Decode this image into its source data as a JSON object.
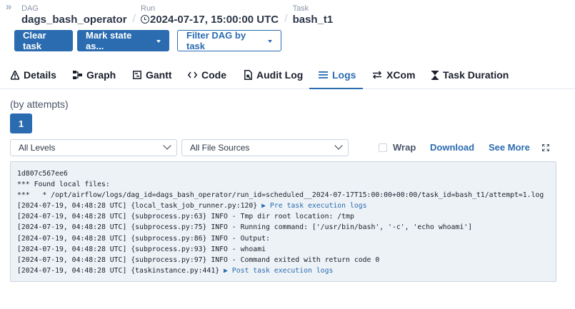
{
  "header": {
    "expand_icon": "double-chevron-right",
    "breadcrumbs": [
      {
        "label": "DAG",
        "value": "dags_bash_operator"
      },
      {
        "label": "Run",
        "value": "2024-07-17, 15:00:00 UTC",
        "icon": "clock-icon"
      },
      {
        "label": "Task",
        "value": "bash_t1"
      }
    ]
  },
  "actions": {
    "clear_task": "Clear task",
    "mark_state": "Mark state as...",
    "filter_dag": "Filter DAG by task"
  },
  "tabs": [
    {
      "label": "Details",
      "icon": "details-icon"
    },
    {
      "label": "Graph",
      "icon": "graph-icon"
    },
    {
      "label": "Gantt",
      "icon": "gantt-icon"
    },
    {
      "label": "Code",
      "icon": "code-icon"
    },
    {
      "label": "Audit Log",
      "icon": "audit-log-icon"
    },
    {
      "label": "Logs",
      "icon": "logs-icon",
      "active": true
    },
    {
      "label": "XCom",
      "icon": "xcom-icon"
    },
    {
      "label": "Task Duration",
      "icon": "hourglass-icon"
    }
  ],
  "logs": {
    "attempts_label": "(by attempts)",
    "attempt_number": "1",
    "level_select": "All Levels",
    "source_select": "All File Sources",
    "wrap_label": "Wrap",
    "download_label": "Download",
    "see_more_label": "See More",
    "lines": [
      {
        "text": "1d807c567ee6"
      },
      {
        "text": "*** Found local files:"
      },
      {
        "text": "***   * /opt/airflow/logs/dag_id=dags_bash_operator/run_id=scheduled__2024-07-17T15:00:00+00:00/task_id=bash_t1/attempt=1.log"
      },
      {
        "text": "[2024-07-19, 04:48:28 UTC] {local_task_job_runner.py:120} ",
        "link": "▶ Pre task execution logs"
      },
      {
        "text": "[2024-07-19, 04:48:28 UTC] {subprocess.py:63} INFO - Tmp dir root location: /tmp"
      },
      {
        "text": "[2024-07-19, 04:48:28 UTC] {subprocess.py:75} INFO - Running command: ['/usr/bin/bash', '-c', 'echo whoami']"
      },
      {
        "text": "[2024-07-19, 04:48:28 UTC] {subprocess.py:86} INFO - Output:"
      },
      {
        "text": "[2024-07-19, 04:48:28 UTC] {subprocess.py:93} INFO - whoami"
      },
      {
        "text": "[2024-07-19, 04:48:28 UTC] {subprocess.py:97} INFO - Command exited with return code 0"
      },
      {
        "text": "[2024-07-19, 04:48:28 UTC] {taskinstance.py:441} ",
        "link": "▶ Post task execution logs"
      }
    ]
  },
  "colors": {
    "accent": "#2b6cb0",
    "log_bg": "#edf2f7"
  }
}
